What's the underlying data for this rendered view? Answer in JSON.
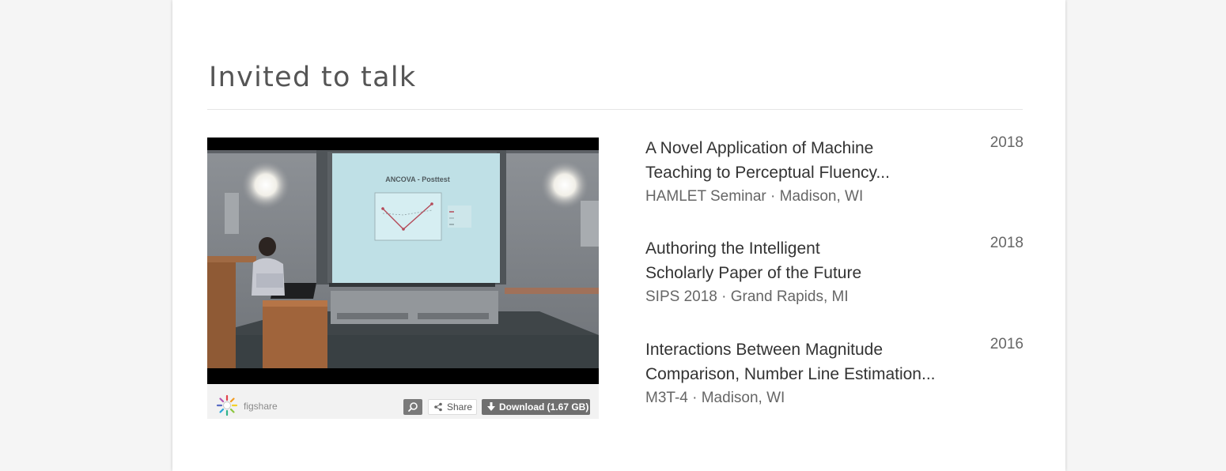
{
  "section": {
    "title": "Invited to talk"
  },
  "player": {
    "brand": "figshare",
    "share_label": "Share",
    "download_label": "Download (1.67 GB)",
    "slide_title": "ANCOVA - Posttest"
  },
  "talks": [
    {
      "title_line1": "A Novel Application of Machine",
      "title_line2": "Teaching to Perceptual Fluency...",
      "venue": "HAMLET Seminar · Madison, WI",
      "year": "2018"
    },
    {
      "title_line1": "Authoring the Intelligent",
      "title_line2": "Scholarly Paper of the Future",
      "venue": "SIPS 2018 · Grand Rapids, MI",
      "year": "2018"
    },
    {
      "title_line1": "Interactions Between Magnitude",
      "title_line2": "Comparison, Number Line Estimation...",
      "venue": "M3T-4 · Madison, WI",
      "year": "2016"
    }
  ]
}
